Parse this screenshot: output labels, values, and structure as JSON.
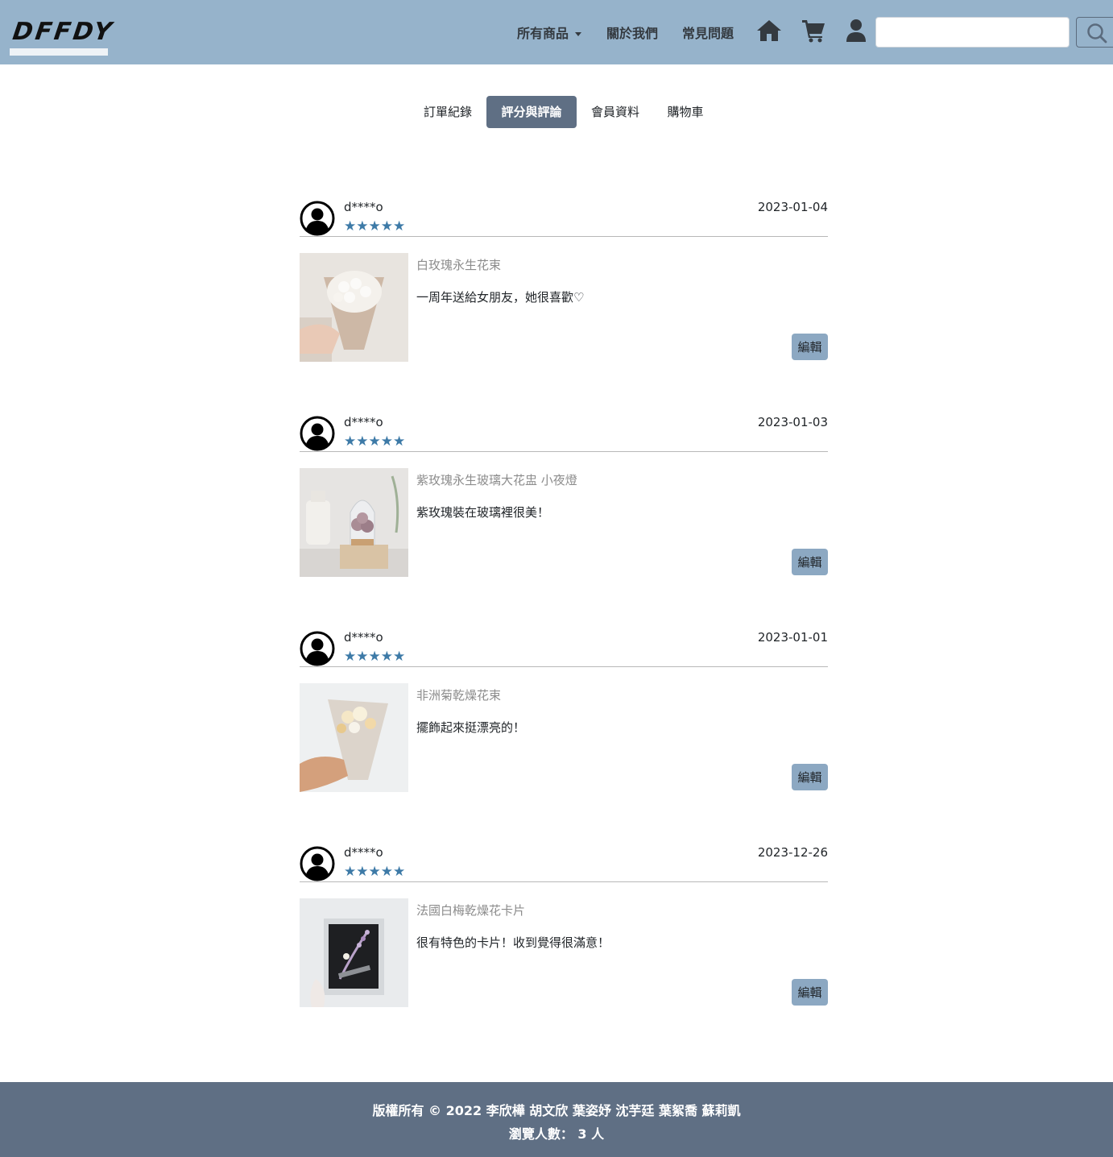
{
  "header": {
    "logo_text": "DFFDY",
    "nav": {
      "all_products": "所有商品",
      "about_us": "關於我們",
      "faq": "常見問題"
    },
    "icons": [
      "home-icon",
      "cart-icon",
      "user-icon",
      "search-icon"
    ],
    "search": {
      "value": "",
      "placeholder": ""
    }
  },
  "tabs": [
    {
      "label": "訂單紀錄",
      "active": false
    },
    {
      "label": "評分與評論",
      "active": true
    },
    {
      "label": "會員資料",
      "active": false
    },
    {
      "label": "購物車",
      "active": false
    }
  ],
  "reviews": [
    {
      "user": "d****o",
      "stars": "★★★★★",
      "rating": 5,
      "date": "2023-01-04",
      "product": "白玫瑰永生花束",
      "comment": "一周年送給女朋友，她很喜歡♡",
      "edit_label": "編輯"
    },
    {
      "user": "d****o",
      "stars": "★★★★★",
      "rating": 5,
      "date": "2023-01-03",
      "product": "紫玫瑰永生玻璃大花盅 小夜燈",
      "comment": "紫玫瑰裝在玻璃裡很美！",
      "edit_label": "編輯"
    },
    {
      "user": "d****o",
      "stars": "★★★★★",
      "rating": 5,
      "date": "2023-01-01",
      "product": "非洲菊乾燥花束",
      "comment": "擺飾起來挺漂亮的！",
      "edit_label": "編輯"
    },
    {
      "user": "d****o",
      "stars": "★★★★★",
      "rating": 5,
      "date": "2023-12-26",
      "product": "法國白梅乾燥花卡片",
      "comment": "很有特色的卡片！收到覺得很滿意！",
      "edit_label": "編輯"
    }
  ],
  "footer": {
    "copyright": "版權所有 © 2022 李欣樺 胡文欣 葉姿妤 沈芋廷 葉絮喬 蘇莉凱",
    "visitors": "瀏覽人數： 3 人"
  },
  "colors": {
    "navbar": "#96b3cb",
    "tab_active": "#5f6f84",
    "star": "#3d7aa7",
    "edit_button": "#8ca8c2",
    "footer": "#5f6f84"
  }
}
